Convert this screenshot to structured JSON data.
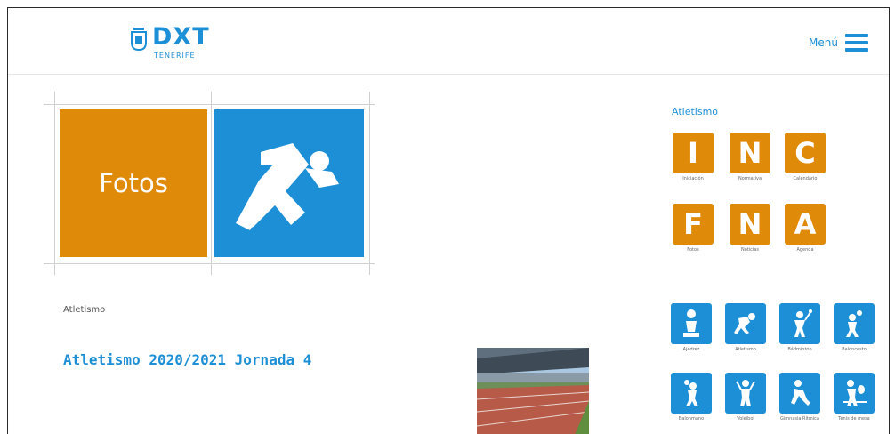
{
  "header": {
    "logo_text": "DXT",
    "logo_subtext": "TENERIFE",
    "menu_label": "Menú"
  },
  "banner": {
    "fotos_label": "Fotos"
  },
  "content": {
    "breadcrumb": "Atletismo",
    "article_title": "Atletismo 2020/2021 Jornada 4"
  },
  "sidebar": {
    "title": "Atletismo",
    "letter_tiles": [
      {
        "letter": "I",
        "caption": "Iniciación"
      },
      {
        "letter": "N",
        "caption": "Normativa"
      },
      {
        "letter": "C",
        "caption": "Calendario"
      },
      {
        "letter": "F",
        "caption": "Fotos"
      },
      {
        "letter": "N",
        "caption": "Noticias"
      },
      {
        "letter": "A",
        "caption": "Agenda"
      }
    ],
    "sport_tiles": [
      {
        "icon": "chess-icon",
        "caption": "Ajedrez"
      },
      {
        "icon": "athletics-icon",
        "caption": "Atletismo"
      },
      {
        "icon": "badminton-icon",
        "caption": "Bádminton"
      },
      {
        "icon": "basketball-icon",
        "caption": "Baloncesto"
      },
      {
        "icon": "handball-icon",
        "caption": "Balonmano"
      },
      {
        "icon": "volleyball-icon",
        "caption": "Voleibol"
      },
      {
        "icon": "gymnastics-icon",
        "caption": "Gimnasia Rítmica"
      },
      {
        "icon": "table-tennis-icon",
        "caption": "Tenis de mesa"
      }
    ]
  },
  "colors": {
    "brand_blue": "#1d8fd6",
    "brand_orange": "#e08a0a"
  }
}
